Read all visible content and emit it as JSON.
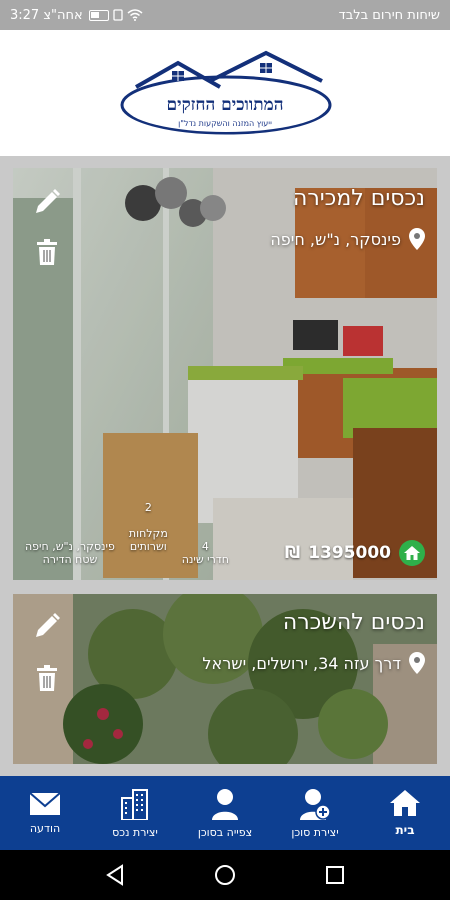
{
  "status_bar": {
    "carrier_text": "שיחות חירום בלבד",
    "time": "אחה\"צ 3:27"
  },
  "logo": {
    "title": "המתווכים החזקים",
    "subtitle": "ייעוץ המזנה והשקעות נדל\"ן"
  },
  "listings": [
    {
      "title": "נכסים למכירה",
      "address": "פינסקר, נ\"ש, חיפה",
      "price": "1395000",
      "currency": "₪",
      "stats": [
        {
          "value": "4",
          "label": "חדרי שינה"
        },
        {
          "value": "2",
          "label": "מקלחות\nושרותים"
        },
        {
          "value": "פינסקר, נ\"ש, חיפה",
          "label": "שטח הדירה"
        }
      ]
    },
    {
      "title": "נכסים להשכרה",
      "address": "דרך עזה 34, ירושלים, ישראל"
    }
  ],
  "bottom_nav": [
    {
      "icon": "envelope-icon",
      "label": "הודעה"
    },
    {
      "icon": "buildings-icon",
      "label": "יצירת נכס"
    },
    {
      "icon": "person-icon",
      "label": "צפייה בסוכן"
    },
    {
      "icon": "add-person-icon",
      "label": "יצירת סוכן"
    },
    {
      "icon": "home-icon",
      "label": "בית",
      "active": true
    }
  ],
  "colors": {
    "nav_bg": "#0d3f91",
    "accent_green": "#2fb04a",
    "logo_blue": "#13307a"
  }
}
